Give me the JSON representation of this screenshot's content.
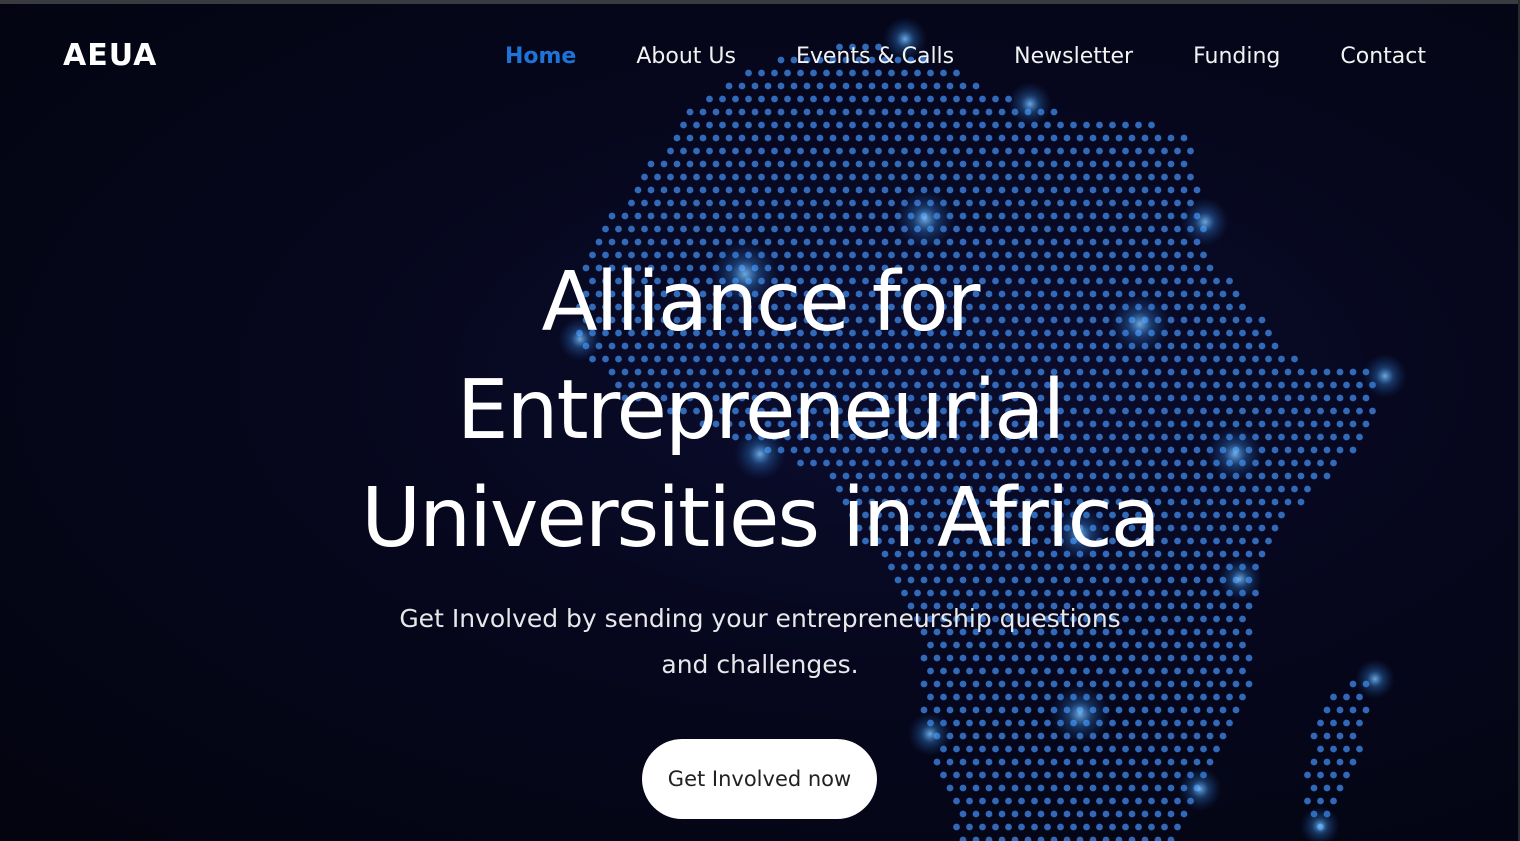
{
  "brand": {
    "name": "AEUA"
  },
  "nav": {
    "items": [
      {
        "label": "Home",
        "active": true
      },
      {
        "label": "About Us",
        "active": false
      },
      {
        "label": "Events & Calls",
        "active": false
      },
      {
        "label": "Newsletter",
        "active": false
      },
      {
        "label": "Funding",
        "active": false
      },
      {
        "label": "Contact",
        "active": false
      }
    ]
  },
  "hero": {
    "title_lines": [
      "Alliance for",
      "Entrepreneurial",
      "Universities in Africa"
    ],
    "subtitle_lines": [
      "Get Involved by sending your entrepreneurship questions",
      "and challenges."
    ],
    "cta_label": "Get Involved now",
    "background_image": "dotted-africa-map"
  },
  "colors": {
    "background": "#05061a",
    "accent": "#1e73d8",
    "dot_color": "#3a7bd5",
    "glow_color": "#4aa8ff",
    "text": "#ffffff"
  }
}
